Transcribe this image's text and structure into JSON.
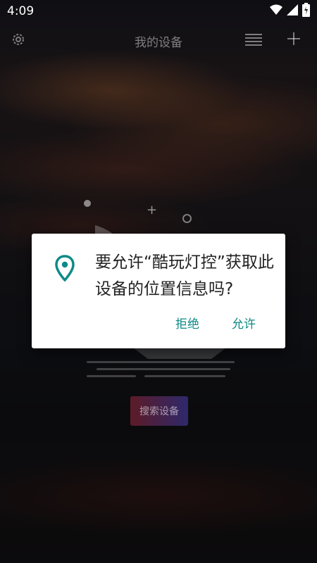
{
  "status_bar": {
    "time": "4:09",
    "icons": [
      "wifi-icon",
      "signal-icon",
      "battery-charging-icon"
    ]
  },
  "header": {
    "title": "我的设备",
    "left_icon": "gear-icon",
    "right_icons": [
      "list-icon",
      "add-icon"
    ]
  },
  "main": {
    "search_button_label": "搜索设备"
  },
  "dialog": {
    "icon": "location-pin-icon",
    "message": "要允许“酷玩灯控”获取此设备的位置信息吗?",
    "deny_label": "拒绝",
    "allow_label": "允许"
  },
  "colors": {
    "accent": "#0e8a86",
    "dialog_background": "#ffffff"
  }
}
